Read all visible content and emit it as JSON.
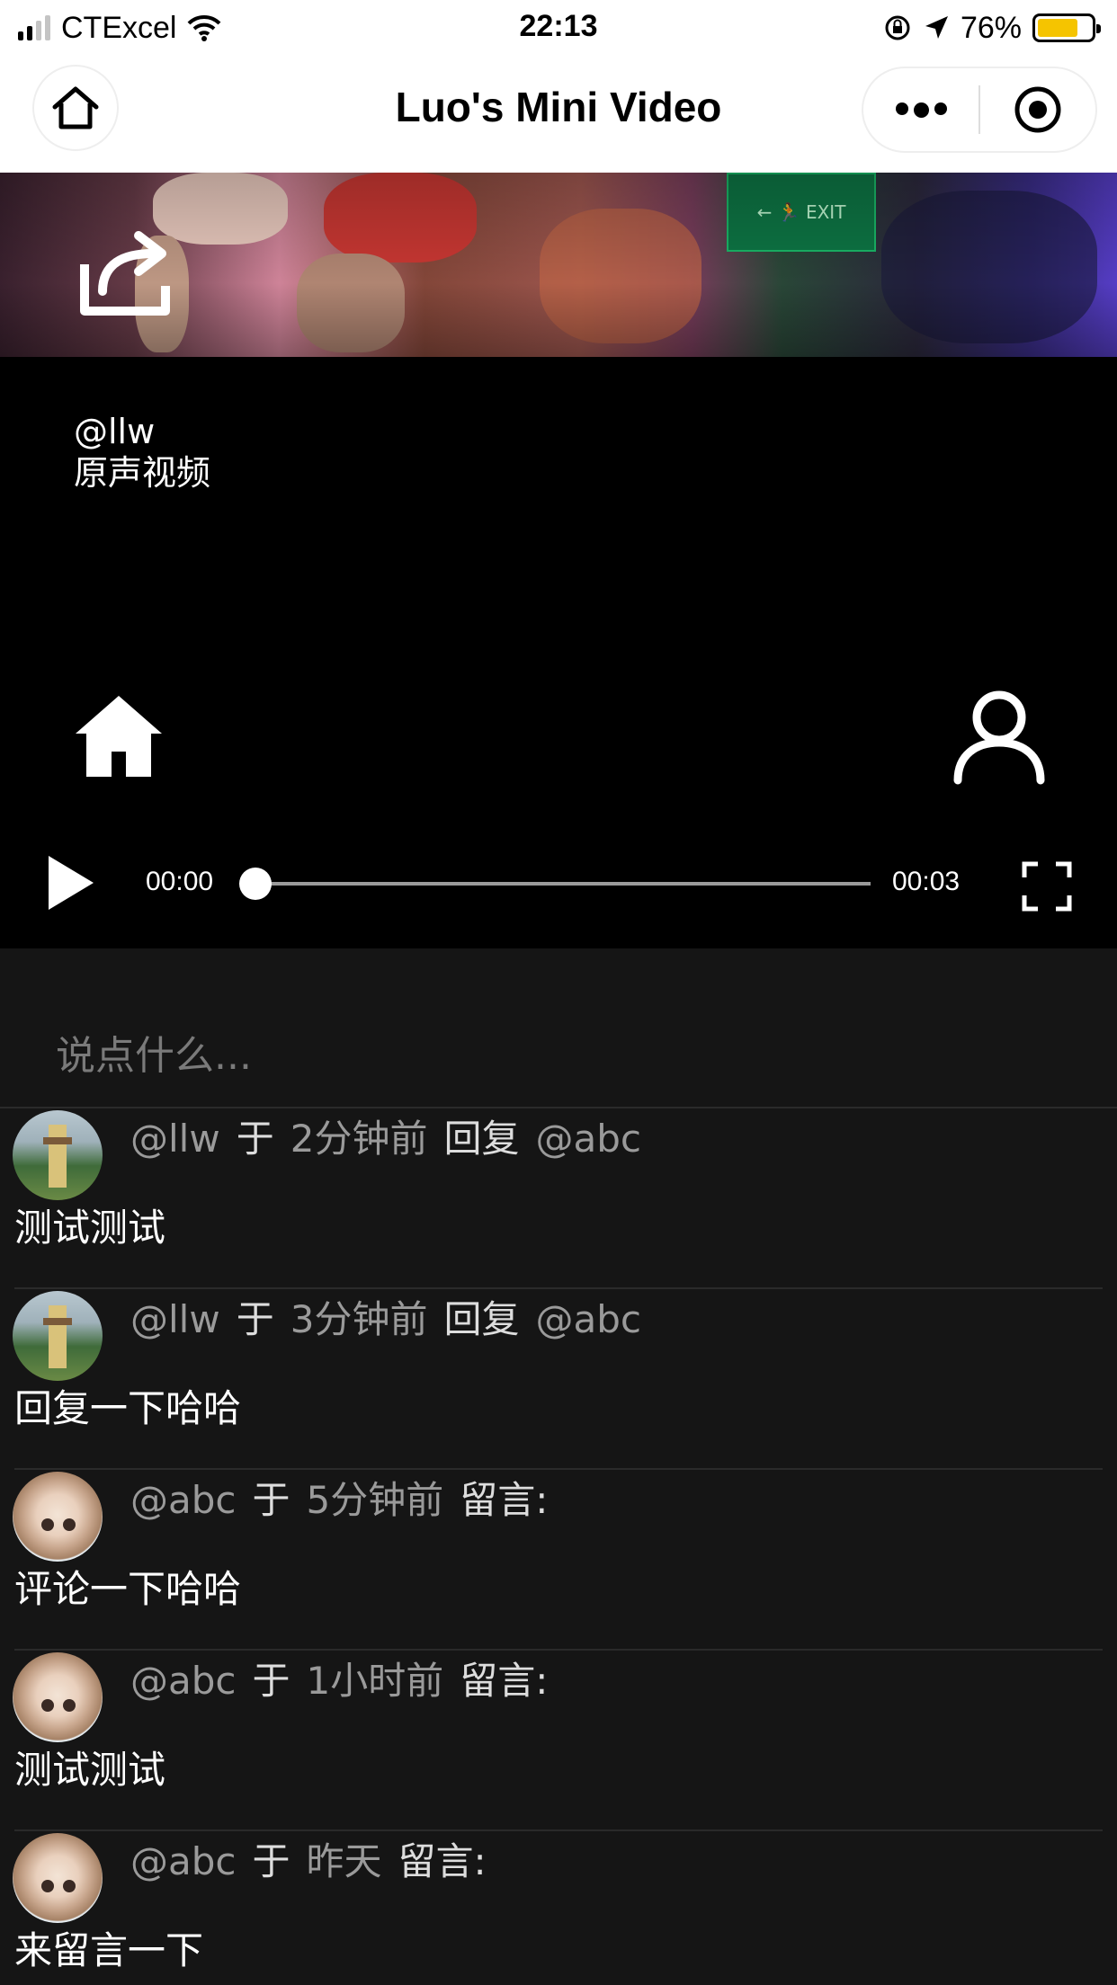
{
  "status_bar": {
    "carrier": "CTExcel",
    "time": "22:13",
    "battery_percent": "76%",
    "battery_level": 0.76,
    "icons": [
      "signal-icon",
      "wifi-icon",
      "orientation-lock-icon",
      "location-icon",
      "battery-icon"
    ]
  },
  "navbar": {
    "title": "Luo's Mini Video",
    "icons": [
      "home-outline-icon",
      "more-dots-icon",
      "close-circle-icon"
    ]
  },
  "video": {
    "username": "@llw",
    "description": "原声视频",
    "current_time": "00:00",
    "total_time": "00:03",
    "progress": 0,
    "icons": [
      "share-icon",
      "home-icon",
      "user-icon",
      "play-icon",
      "fullscreen-icon"
    ]
  },
  "comment_input": {
    "placeholder": "说点什么..."
  },
  "comments": [
    {
      "user": "@llw",
      "yu": "于",
      "time": "2分钟前",
      "action": "回复",
      "target": "@abc",
      "text": "测试测试",
      "avatar": "tower"
    },
    {
      "user": "@llw",
      "yu": "于",
      "time": "3分钟前",
      "action": "回复",
      "target": "@abc",
      "text": "回复一下哈哈",
      "avatar": "tower"
    },
    {
      "user": "@abc",
      "yu": "于",
      "time": "5分钟前",
      "action": "留言:",
      "target": "",
      "text": "评论一下哈哈",
      "avatar": "anime"
    },
    {
      "user": "@abc",
      "yu": "于",
      "time": "1小时前",
      "action": "留言:",
      "target": "",
      "text": "测试测试",
      "avatar": "anime"
    },
    {
      "user": "@abc",
      "yu": "于",
      "time": "昨天",
      "action": "留言:",
      "target": "",
      "text": "来留言一下",
      "avatar": "anime"
    }
  ]
}
